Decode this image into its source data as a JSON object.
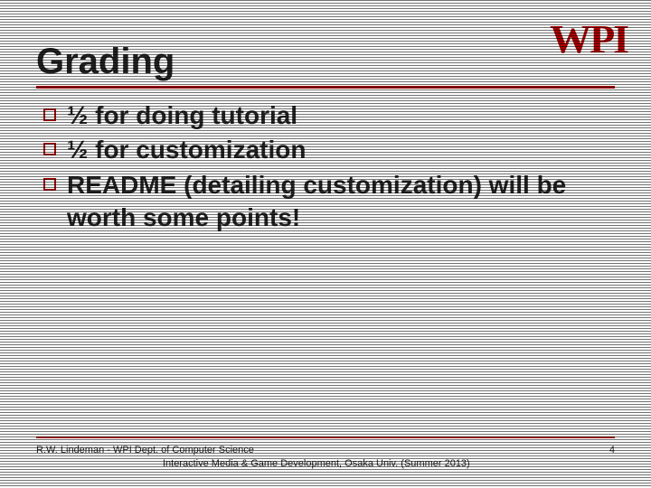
{
  "logo": "WPI",
  "title": "Grading",
  "bullets": [
    "½ for doing tutorial",
    "½ for customization",
    "README (detailing customization) will be worth some points!"
  ],
  "footer": {
    "line1": "R.W. Lindeman - WPI Dept. of Computer Science",
    "line2": "Interactive Media & Game Development, Osaka Univ. (Summer 2013)",
    "page": "4"
  }
}
